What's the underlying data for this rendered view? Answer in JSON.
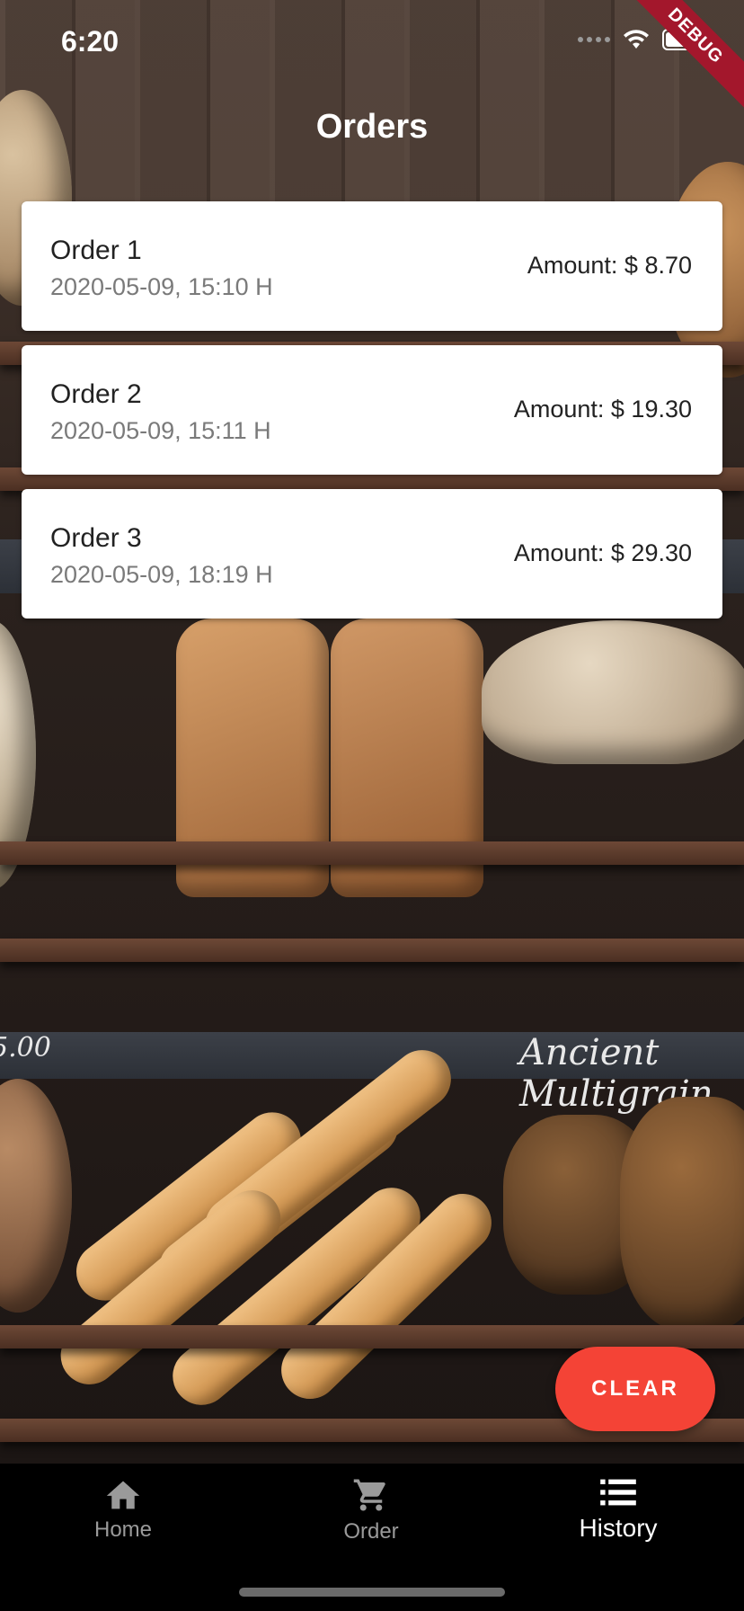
{
  "status_bar": {
    "time": "6:20"
  },
  "debug_banner": "DEBUG",
  "header": {
    "title": "Orders"
  },
  "orders": [
    {
      "name": "Order 1",
      "datetime": "2020-05-09,  15:10 H",
      "amount": "Amount: $ 8.70"
    },
    {
      "name": "Order 2",
      "datetime": "2020-05-09,  15:11 H",
      "amount": "Amount: $ 19.30"
    },
    {
      "name": "Order 3",
      "datetime": "2020-05-09,  18:19 H",
      "amount": "Amount: $ 29.30"
    }
  ],
  "background": {
    "chalk_left": "5.00",
    "chalk_right": "Ancient Multigrain"
  },
  "fab": {
    "label": "CLEAR",
    "color": "#f44336"
  },
  "bottom_nav": {
    "items": [
      {
        "label": "Home",
        "icon": "home-icon",
        "active": false
      },
      {
        "label": "Order",
        "icon": "cart-icon",
        "active": false
      },
      {
        "label": "History",
        "icon": "list-icon",
        "active": true
      }
    ]
  }
}
